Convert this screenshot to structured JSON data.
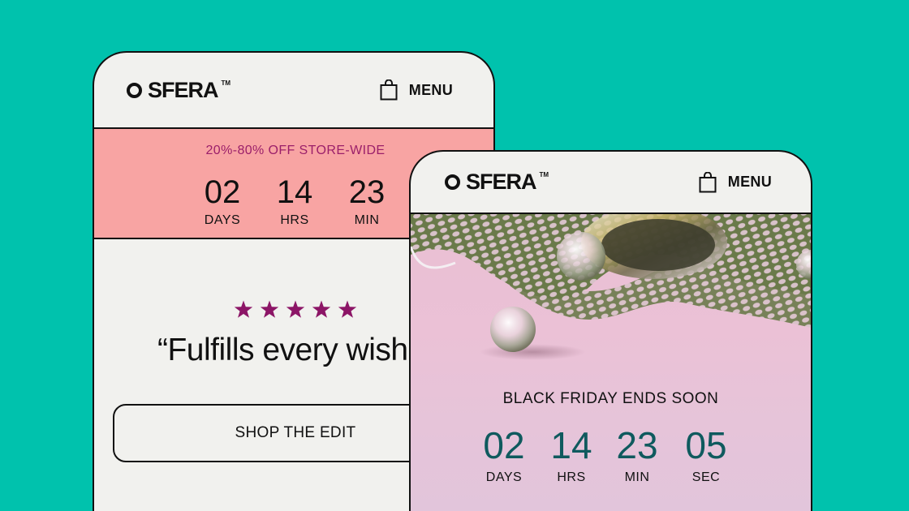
{
  "back_phone": {
    "brand": "SFERA",
    "trademark": "TM",
    "menu_label": "MENU",
    "promo_text": "20%-80% OFF STORE-WIDE",
    "countdown": [
      {
        "value": "02",
        "label": "DAYS"
      },
      {
        "value": "14",
        "label": "HRS"
      },
      {
        "value": "23",
        "label": "MIN"
      }
    ],
    "rating_stars": 5,
    "quote": "“Fulfills every wish",
    "cta_label": "SHOP THE EDIT"
  },
  "front_phone": {
    "brand": "SFERA",
    "trademark": "TM",
    "menu_label": "MENU",
    "headline": "BLACK FRIDAY ENDS SOON",
    "countdown": [
      {
        "value": "02",
        "label": "DAYS"
      },
      {
        "value": "14",
        "label": "HRS"
      },
      {
        "value": "23",
        "label": "MIN"
      },
      {
        "value": "05",
        "label": "SEC"
      }
    ]
  },
  "colors": {
    "background": "#00c2ad",
    "promo_band": "#f8a4a3",
    "promo_text": "#9b1f6a",
    "stars": "#8c1566",
    "countdown_teal": "#0f5a5e"
  },
  "icons": [
    "shopping-bag-icon",
    "star-icon"
  ]
}
